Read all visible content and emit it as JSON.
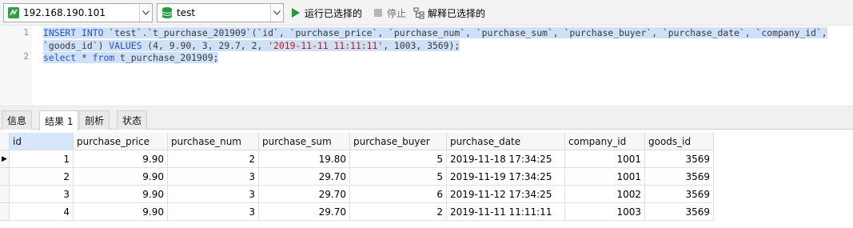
{
  "toolbar": {
    "connection": "192.168.190.101",
    "database": "test",
    "run_selected_label": "运行已选择的",
    "stop_label": "停止",
    "explain_selected_label": "解释已选择的"
  },
  "editor": {
    "line_numbers": [
      "1",
      "2"
    ],
    "line1a_kw1": "INSERT INTO",
    "line1a_rest": " `test`.`t_purchase_201909`(`id`, `purchase_price`, `purchase_num`, `purchase_sum`, `purchase_buyer`, `purchase_date`, `company_id`,",
    "line1b_ids": "`goods_id`) ",
    "line1b_kw": "VALUES",
    "line1b_vals": " (4, 9.90, 3, 29.7, 2, ",
    "line1b_str": "'2019-11-11 11:11:11'",
    "line1b_tail": ", 1003, 3569);",
    "line2_kw1": "select",
    "line2_mid": " * ",
    "line2_kw2": "from",
    "line2_tail": " t_purchase_201909;"
  },
  "tabs": [
    "信息",
    "结果 1",
    "剖析",
    "状态"
  ],
  "active_tab": "结果 1",
  "grid": {
    "columns": [
      "id",
      "purchase_price",
      "purchase_num",
      "purchase_sum",
      "purchase_buyer",
      "purchase_date",
      "company_id",
      "goods_id"
    ],
    "rows": [
      [
        "1",
        "9.90",
        "2",
        "19.80",
        "5",
        "2019-11-18 17:34:25",
        "1001",
        "3569"
      ],
      [
        "2",
        "9.90",
        "3",
        "29.70",
        "5",
        "2019-11-19 17:34:25",
        "1001",
        "3569"
      ],
      [
        "3",
        "9.90",
        "3",
        "29.70",
        "6",
        "2019-11-12 17:34:25",
        "1002",
        "3569"
      ],
      [
        "4",
        "9.90",
        "3",
        "29.70",
        "2",
        "2019-11-11 11:11:11",
        "1003",
        "3569"
      ]
    ],
    "current_row_marker": "▶"
  },
  "colors": {
    "keyword": "#2a4fd0",
    "string": "#c01818",
    "selection": "#cfe1f9",
    "run_icon": "#1a9e3a"
  },
  "icons": [
    "connection-icon",
    "database-icon",
    "run-icon",
    "stop-icon",
    "explain-icon",
    "chevron-down-icon"
  ]
}
